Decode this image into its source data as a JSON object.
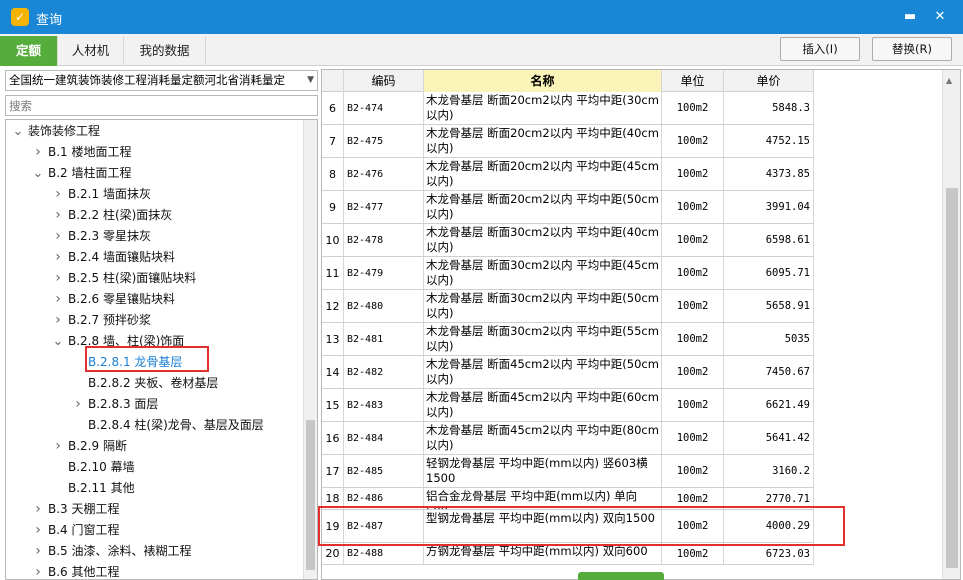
{
  "window": {
    "title": "查询",
    "app_icon": "app-logo-icon",
    "minimize_glyph": "▬",
    "close_glyph": "✕"
  },
  "tabs": [
    {
      "label": "定额",
      "active": true
    },
    {
      "label": "人材机",
      "active": false
    },
    {
      "label": "我的数据",
      "active": false
    }
  ],
  "actions": {
    "insert_label": "插入(I)",
    "replace_label": "替换(R)"
  },
  "left_panel": {
    "library_selected": "全国统一建筑装饰装修工程消耗量定额河北省消耗量定",
    "search_placeholder": "搜索",
    "tree": [
      {
        "label": "装饰装修工程",
        "level": 0,
        "expanded": true
      },
      {
        "label": "B.1 楼地面工程",
        "level": 1,
        "expanded": false
      },
      {
        "label": "B.2 墙柱面工程",
        "level": 1,
        "expanded": true
      },
      {
        "label": "B.2.1 墙面抹灰",
        "level": 2,
        "expanded": false
      },
      {
        "label": "B.2.2 柱(梁)面抹灰",
        "level": 2,
        "expanded": false
      },
      {
        "label": "B.2.3 零星抹灰",
        "level": 2,
        "expanded": false
      },
      {
        "label": "B.2.4 墙面镶贴块料",
        "level": 2,
        "expanded": false
      },
      {
        "label": "B.2.5 柱(梁)面镶贴块料",
        "level": 2,
        "expanded": false
      },
      {
        "label": "B.2.6 零星镶贴块料",
        "level": 2,
        "expanded": false
      },
      {
        "label": "B.2.7 预拌砂浆",
        "level": 2,
        "expanded": false
      },
      {
        "label": "B.2.8 墙、柱(梁)饰面",
        "level": 2,
        "expanded": true
      },
      {
        "label": "B.2.8.1 龙骨基层",
        "level": 3,
        "leaf": true,
        "selected": true
      },
      {
        "label": "B.2.8.2 夹板、卷材基层",
        "level": 3,
        "leaf": true
      },
      {
        "label": "B.2.8.3 面层",
        "level": 3,
        "expanded": false
      },
      {
        "label": "B.2.8.4 柱(梁)龙骨、基层及面层",
        "level": 3,
        "leaf": true
      },
      {
        "label": "B.2.9 隔断",
        "level": 2,
        "expanded": false
      },
      {
        "label": "B.2.10 幕墙",
        "level": 2,
        "leaf": true
      },
      {
        "label": "B.2.11 其他",
        "level": 2,
        "leaf": true
      },
      {
        "label": "B.3 天棚工程",
        "level": 1,
        "expanded": false
      },
      {
        "label": "B.4 门窗工程",
        "level": 1,
        "expanded": false
      },
      {
        "label": "B.5 油漆、涂料、裱糊工程",
        "level": 1,
        "expanded": false
      },
      {
        "label": "B.6 其他工程",
        "level": 1,
        "expanded": false
      }
    ]
  },
  "table": {
    "headers": {
      "code": "编码",
      "name": "名称",
      "unit": "单位",
      "price": "单价"
    },
    "rows": [
      {
        "idx": "6",
        "code": "B2-474",
        "name": "木龙骨基层 断面20cm2以内 平均中距(30cm以内)",
        "unit": "100m2",
        "price": "5848.3"
      },
      {
        "idx": "7",
        "code": "B2-475",
        "name": "木龙骨基层 断面20cm2以内 平均中距(40cm以内)",
        "unit": "100m2",
        "price": "4752.15"
      },
      {
        "idx": "8",
        "code": "B2-476",
        "name": "木龙骨基层 断面20cm2以内 平均中距(45cm以内)",
        "unit": "100m2",
        "price": "4373.85"
      },
      {
        "idx": "9",
        "code": "B2-477",
        "name": "木龙骨基层 断面20cm2以内 平均中距(50cm以内)",
        "unit": "100m2",
        "price": "3991.04"
      },
      {
        "idx": "10",
        "code": "B2-478",
        "name": "木龙骨基层 断面30cm2以内 平均中距(40cm以内)",
        "unit": "100m2",
        "price": "6598.61"
      },
      {
        "idx": "11",
        "code": "B2-479",
        "name": "木龙骨基层 断面30cm2以内 平均中距(45cm以内)",
        "unit": "100m2",
        "price": "6095.71"
      },
      {
        "idx": "12",
        "code": "B2-480",
        "name": "木龙骨基层 断面30cm2以内 平均中距(50cm以内)",
        "unit": "100m2",
        "price": "5658.91"
      },
      {
        "idx": "13",
        "code": "B2-481",
        "name": "木龙骨基层 断面30cm2以内 平均中距(55cm以内)",
        "unit": "100m2",
        "price": "5035"
      },
      {
        "idx": "14",
        "code": "B2-482",
        "name": "木龙骨基层 断面45cm2以内 平均中距(50cm以内)",
        "unit": "100m2",
        "price": "7450.67"
      },
      {
        "idx": "15",
        "code": "B2-483",
        "name": "木龙骨基层 断面45cm2以内 平均中距(60cm以内)",
        "unit": "100m2",
        "price": "6621.49"
      },
      {
        "idx": "16",
        "code": "B2-484",
        "name": "木龙骨基层 断面45cm2以内 平均中距(80cm以内)",
        "unit": "100m2",
        "price": "5641.42"
      },
      {
        "idx": "17",
        "code": "B2-485",
        "name": "轻钢龙骨基层 平均中距(mm以内) 竖603横1500",
        "unit": "100m2",
        "price": "3160.2"
      },
      {
        "idx": "18",
        "code": "B2-486",
        "name": "铝合金龙骨基层 平均中距(mm以内) 单向500",
        "unit": "100m2",
        "price": "2770.71"
      },
      {
        "idx": "19",
        "code": "B2-487",
        "name": "型钢龙骨基层 平均中距(mm以内) 双向1500",
        "unit": "100m2",
        "price": "4000.29"
      },
      {
        "idx": "20",
        "code": "B2-488",
        "name": "方钢龙骨基层 平均中距(mm以内) 双向600",
        "unit": "100m2",
        "price": "6723.03"
      }
    ]
  },
  "colors": {
    "titlebar": "#1a87d6",
    "active_tab": "#56ad3b",
    "highlight_box": "#e0302f",
    "selected_text": "#1a7ed6",
    "name_header": "#fbf4b8"
  }
}
